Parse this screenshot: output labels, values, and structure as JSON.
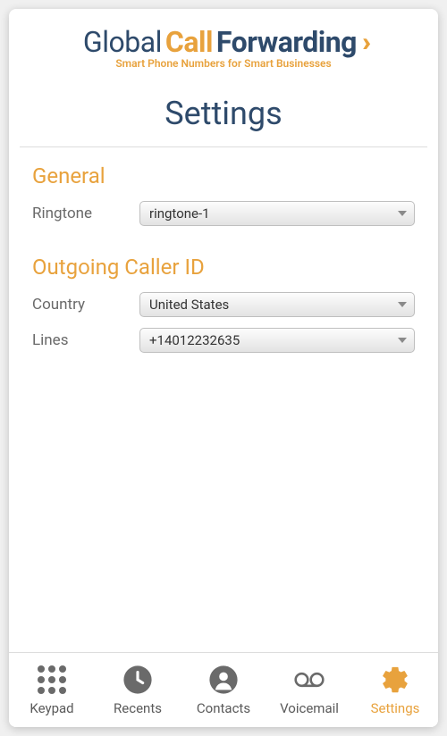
{
  "logo": {
    "word1": "Global",
    "word2": "Call",
    "word3": "Forwarding",
    "tagline": "Smart Phone Numbers for Smart Businesses"
  },
  "page_title": "Settings",
  "sections": {
    "general": {
      "title": "General",
      "ringtone_label": "Ringtone",
      "ringtone_value": "ringtone-1"
    },
    "caller_id": {
      "title": "Outgoing Caller ID",
      "country_label": "Country",
      "country_value": "United States",
      "lines_label": "Lines",
      "lines_value": "+14012232635"
    }
  },
  "tabs": {
    "keypad": "Keypad",
    "recents": "Recents",
    "contacts": "Contacts",
    "voicemail": "Voicemail",
    "settings": "Settings"
  }
}
